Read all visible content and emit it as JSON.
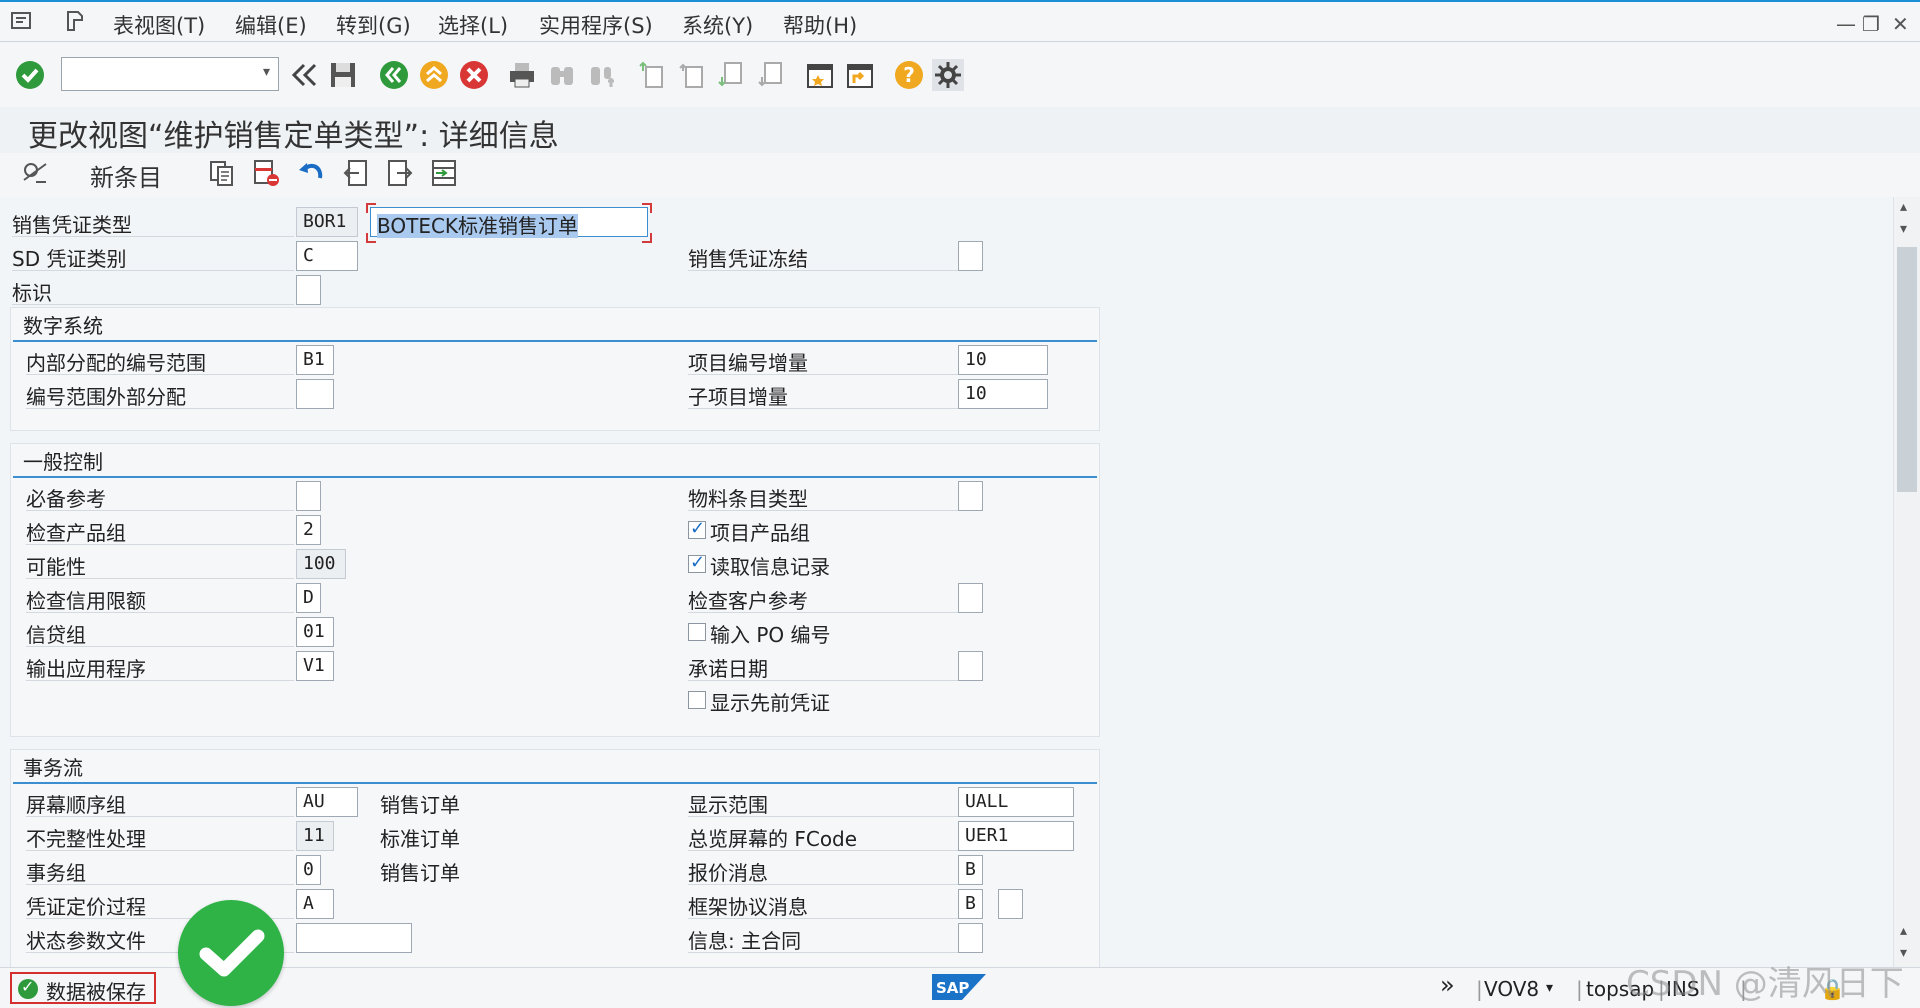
{
  "menu": {
    "items": [
      "表视图(T)",
      "编辑(E)",
      "转到(G)",
      "选择(L)",
      "实用程序(S)",
      "系统(Y)",
      "帮助(H)"
    ]
  },
  "title": "更改视图“维护销售定单类型”: 详细信息",
  "app_toolbar": {
    "new_entries_label": "新条目"
  },
  "header": {
    "doc_type_label": "销售凭证类型",
    "doc_type_value": "BOR1",
    "doc_type_desc": "BOTECK标准销售订单",
    "sd_cat_label": "SD 凭证类别",
    "sd_cat_value": "C",
    "block_label": "销售凭证冻结",
    "indicator_label": "标识"
  },
  "number_system": {
    "title": "数字系统",
    "int_range_label": "内部分配的编号范围",
    "int_range_value": "B1",
    "ext_range_label": "编号范围外部分配",
    "ext_range_value": "",
    "item_incr_label": "项目编号增量",
    "item_incr_value": "10",
    "sub_incr_label": "子项目增量",
    "sub_incr_value": "10"
  },
  "general_control": {
    "title": "一般控制",
    "ref_mandatory_label": "必备参考",
    "check_div_label": "检查产品组",
    "check_div_value": "2",
    "probability_label": "可能性",
    "probability_value": "100",
    "check_credit_label": "检查信用限额",
    "check_credit_value": "D",
    "credit_group_label": "信贷组",
    "credit_group_value": "01",
    "output_app_label": "输出应用程序",
    "output_app_value": "V1",
    "material_entry_label": "物料条目类型",
    "item_division_label": "项目产品组",
    "read_info_label": "读取信息记录",
    "check_cust_ref_label": "检查客户参考",
    "enter_po_label": "输入 PO 编号",
    "commit_date_label": "承诺日期",
    "display_prec_label": "显示先前凭证"
  },
  "transaction_flow": {
    "title": "事务流",
    "screen_seq_label": "屏幕顺序组",
    "screen_seq_value": "AU",
    "screen_seq_desc": "销售订单",
    "incomplete_label": "不完整性处理",
    "incomplete_value": "11",
    "incomplete_desc": "标准订单",
    "trans_group_label": "事务组",
    "trans_group_value": "0",
    "trans_group_desc": "销售订单",
    "pricing_label": "凭证定价过程",
    "pricing_value": "A",
    "status_profile_label": "状态参数文件",
    "status_profile_value": "",
    "display_range_label": "显示范围",
    "display_range_value": "UALL",
    "fcode_label": "总览屏幕的 FCode",
    "fcode_value": "UER1",
    "quote_msg_label": "报价消息",
    "quote_msg_value": "B",
    "outline_msg_label": "框架协议消息",
    "outline_msg_value": "B",
    "master_contract_label": "信息: 主合同"
  },
  "status_bar": {
    "message": "数据被保存",
    "transaction": "VOV8",
    "system": "topsap",
    "mode": "INS"
  },
  "watermark": "CSDN @清风日下",
  "colors": {
    "accent": "#1a8fd6",
    "ok": "#2e9a3c",
    "cancel": "#d93636",
    "back": "#2e9a3c",
    "exit": "#f0a820"
  }
}
